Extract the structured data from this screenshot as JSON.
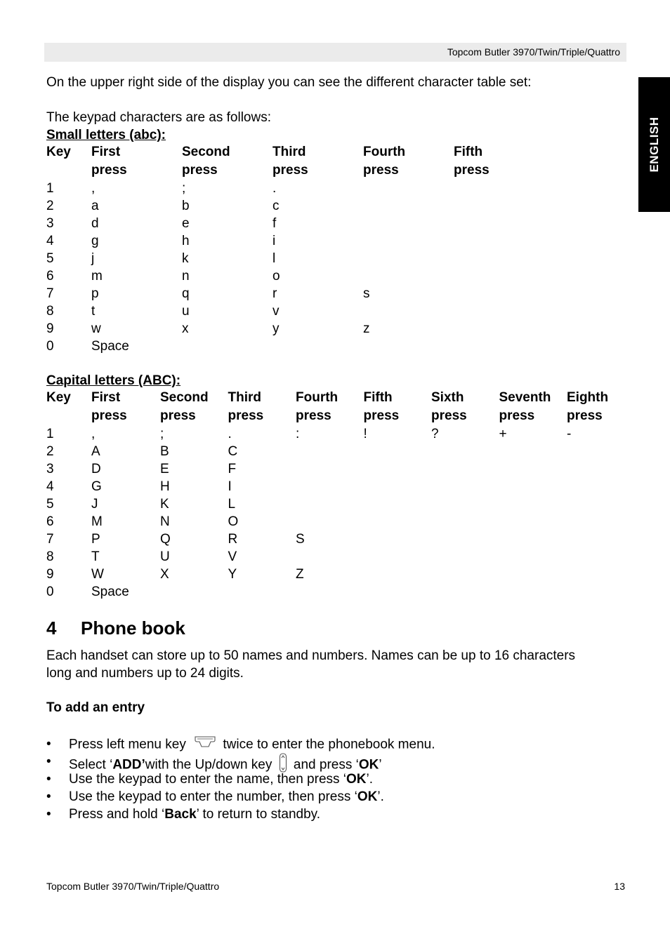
{
  "header": {
    "title": "Topcom Butler 3970/Twin/Triple/Quattro"
  },
  "side_tab": {
    "label": "ENGLISH"
  },
  "intro": "On the upper right side of the display you can see the different character table set:",
  "keypad_intro": "The keypad characters are as follows:",
  "small_letters": {
    "title": "Small letters (abc):",
    "headers": [
      [
        "Key",
        ""
      ],
      [
        "First",
        "press"
      ],
      [
        "Second",
        "press"
      ],
      [
        "Third",
        "press"
      ],
      [
        "Fourth",
        "press"
      ],
      [
        "Fifth",
        "press"
      ]
    ],
    "rows": [
      [
        "1",
        ",",
        ";",
        ".",
        "",
        ""
      ],
      [
        "2",
        "a",
        "b",
        "c",
        "",
        ""
      ],
      [
        "3",
        "d",
        "e",
        "f",
        "",
        ""
      ],
      [
        "4",
        "g",
        "h",
        "i",
        "",
        ""
      ],
      [
        "5",
        "j",
        "k",
        "l",
        "",
        ""
      ],
      [
        "6",
        "m",
        "n",
        "o",
        "",
        ""
      ],
      [
        "7",
        "p",
        "q",
        "r",
        "s",
        ""
      ],
      [
        "8",
        "t",
        "u",
        "v",
        "",
        ""
      ],
      [
        "9",
        "w",
        "x",
        "y",
        "z",
        ""
      ],
      [
        "0",
        "Space",
        "",
        "",
        "",
        ""
      ]
    ]
  },
  "capital_letters": {
    "title": "Capital letters (ABC):",
    "headers": [
      [
        "Key",
        ""
      ],
      [
        "First",
        "press"
      ],
      [
        "Second",
        "press"
      ],
      [
        "Third",
        "press"
      ],
      [
        "Fourth",
        "press"
      ],
      [
        "Fifth",
        "press"
      ],
      [
        "Sixth",
        "press"
      ],
      [
        "Seventh",
        "press"
      ],
      [
        "Eighth",
        "press"
      ]
    ],
    "rows": [
      [
        "1",
        ",",
        ";",
        ".",
        ":",
        "!",
        "?",
        "+",
        "-"
      ],
      [
        "2",
        "A",
        "B",
        "C",
        "",
        "",
        "",
        "",
        ""
      ],
      [
        "3",
        "D",
        "E",
        "F",
        "",
        "",
        "",
        "",
        ""
      ],
      [
        "4",
        "G",
        "H",
        "I",
        "",
        "",
        "",
        "",
        ""
      ],
      [
        "5",
        "J",
        "K",
        "L",
        "",
        "",
        "",
        "",
        ""
      ],
      [
        "6",
        "M",
        "N",
        "O",
        "",
        "",
        "",
        "",
        ""
      ],
      [
        "7",
        "P",
        "Q",
        "R",
        "S",
        "",
        "",
        "",
        ""
      ],
      [
        "8",
        "T",
        "U",
        "V",
        "",
        "",
        "",
        "",
        ""
      ],
      [
        "9",
        "W",
        "X",
        "Y",
        "Z",
        "",
        "",
        "",
        ""
      ],
      [
        "0",
        "Space",
        "",
        "",
        "",
        "",
        "",
        "",
        ""
      ]
    ]
  },
  "section": {
    "number": "4",
    "title": "Phone book",
    "paragraph_line1": "Each handset can store up to 50 names and numbers. Names can be up to 16 characters",
    "paragraph_line2": "long and numbers up to 24 digits.",
    "subheading": "To add an entry",
    "bullet": "•",
    "steps": [
      {
        "before": "Press left menu key ",
        "icon": "menu-key-icon",
        "after": " twice to enter the phonebook menu."
      },
      {
        "before": "Select ‘",
        "bold1": "ADD’",
        "mid": "with the Up/down key ",
        "icon": "up-down-key-icon",
        "mid2": " and press ‘",
        "bold2": "OK",
        "after": "’"
      },
      {
        "before": "Use the keypad to enter the name, then press ‘",
        "bold": "OK",
        "after": "’."
      },
      {
        "before": "Use the keypad to enter the number, then press ‘",
        "bold": "OK",
        "after": "’."
      },
      {
        "before": "Press and hold ‘",
        "bold": "Back",
        "after": "’ to return to standby."
      }
    ]
  },
  "footer": {
    "left": "Topcom Butler 3970/Twin/Triple/Quattro",
    "page_number": "13"
  }
}
